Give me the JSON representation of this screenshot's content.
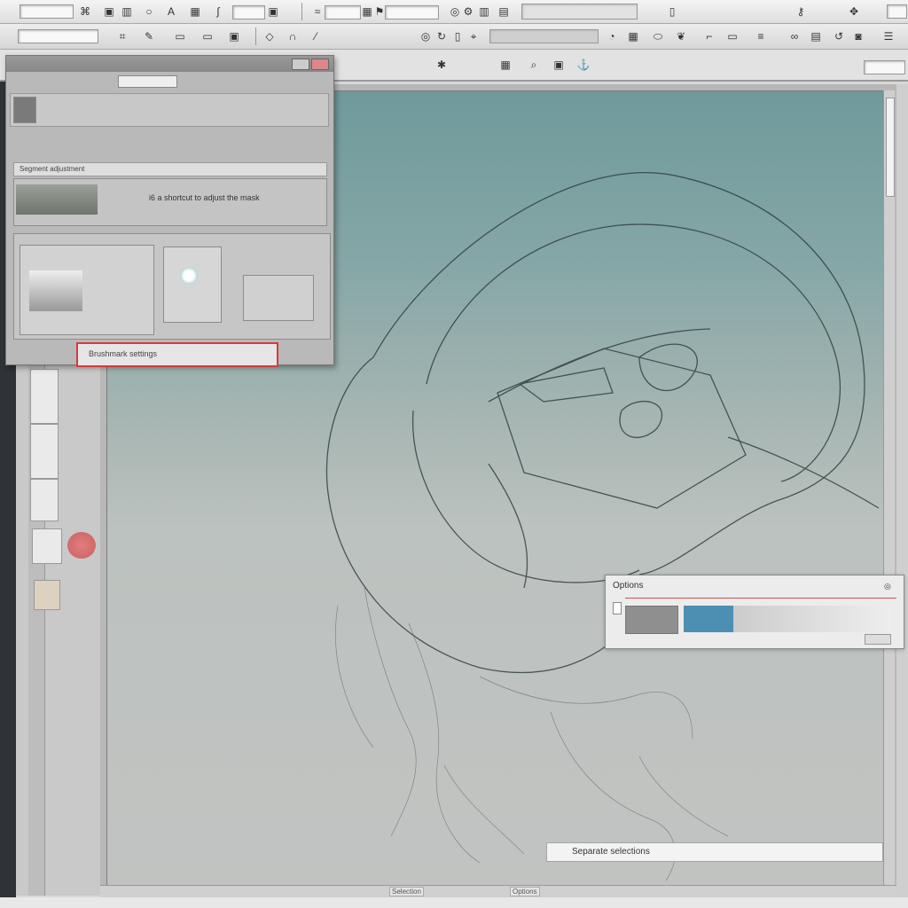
{
  "dialog": {
    "title": "",
    "field_value": "",
    "row_label": "Segment adjustment",
    "main_label": "i6 a shortcut to adjust the mask",
    "red_label": "Brushmark settings"
  },
  "option_panel": {
    "title": "Options",
    "help_icon": "help-icon",
    "swatch_colors": [
      "#8f8f8f",
      "#4d8fb2"
    ]
  },
  "status_field": {
    "text": "Separate selections"
  },
  "bottom_bar": {
    "left_label": "Selection",
    "right_label": "Options"
  },
  "colors": {
    "canvas_top": "#6f9a9c",
    "canvas_bottom": "#c1c3c1",
    "accent_red": "#d63b3b"
  }
}
